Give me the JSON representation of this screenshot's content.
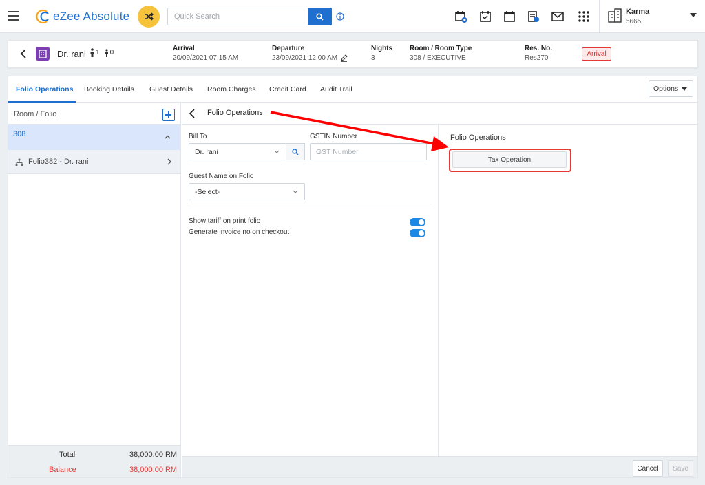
{
  "app": {
    "name": "eZee Absolute"
  },
  "search": {
    "placeholder": "Quick Search"
  },
  "user": {
    "name": "Karma",
    "code": "5665"
  },
  "reservation": {
    "guest_name": "Dr. rani",
    "adults": "1",
    "children": "0",
    "arrival_label": "Arrival",
    "arrival_value": "20/09/2021 07:15 AM",
    "departure_label": "Departure",
    "departure_value": "23/09/2021 12:00 AM",
    "nights_label": "Nights",
    "nights_value": "3",
    "room_label": "Room / Room Type",
    "room_value": "308 / EXECUTIVE",
    "resno_label": "Res. No.",
    "resno_value": "Res270",
    "status": "Arrival"
  },
  "tabs": [
    {
      "label": "Folio Operations",
      "active": true
    },
    {
      "label": "Booking Details"
    },
    {
      "label": "Guest Details"
    },
    {
      "label": "Room Charges"
    },
    {
      "label": "Credit Card"
    },
    {
      "label": "Audit Trail"
    }
  ],
  "options_label": "Options",
  "folio_panel": {
    "title": "Room / Folio",
    "room": "308",
    "folio": "Folio382 - Dr. rani",
    "total_label": "Total",
    "total_value": "38,000.00 RM",
    "balance_label": "Balance",
    "balance_value": "38,000.00 RM"
  },
  "operations": {
    "title": "Folio Operations",
    "bill_to_label": "Bill To",
    "bill_to_value": "Dr. rani",
    "gstin_label": "GSTIN Number",
    "gstin_placeholder": "GST Number",
    "guest_name_label": "Guest Name on Folio",
    "guest_name_value": "-Select-",
    "toggle1_label": "Show tariff on print folio",
    "toggle2_label": "Generate invoice no on checkout",
    "toggle1_on": true,
    "toggle2_on": true
  },
  "right_panel": {
    "title": "Folio Operations",
    "tax_button": "Tax Operation"
  },
  "footer": {
    "cancel": "Cancel",
    "save": "Save"
  },
  "colors": {
    "accent": "#1e6fd0",
    "highlight": "#e53935",
    "shuffle": "#f7c33c"
  }
}
